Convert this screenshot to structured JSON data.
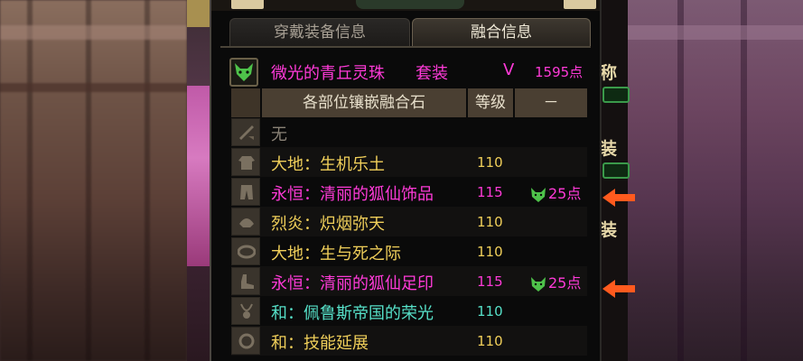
{
  "tabs": {
    "equipped_info": "穿戴装备信息",
    "fusion_info": "融合信息"
  },
  "set": {
    "name": "微光的青丘灵珠",
    "suffix": "套装",
    "grade": "V",
    "points": "1595点"
  },
  "table": {
    "header_name": "各部位镶嵌融合石",
    "header_level": "等级",
    "header_extra": "－",
    "rows": [
      {
        "name": "无",
        "level": "",
        "bonus": "",
        "color": "gray",
        "slot_icon": "weapon-icon"
      },
      {
        "name": "大地：生机乐土",
        "level": "110",
        "bonus": "",
        "color": "yellow",
        "slot_icon": "coat-icon"
      },
      {
        "name": "永恒：清丽的狐仙饰品",
        "level": "115",
        "bonus": "25点",
        "color": "magenta",
        "slot_icon": "pants-icon"
      },
      {
        "name": "烈炎：炽烟弥天",
        "level": "110",
        "bonus": "",
        "color": "yellow",
        "slot_icon": "shoulder-icon"
      },
      {
        "name": "大地：生与死之际",
        "level": "110",
        "bonus": "",
        "color": "yellow",
        "slot_icon": "belt-icon"
      },
      {
        "name": "永恒：清丽的狐仙足印",
        "level": "115",
        "bonus": "25点",
        "color": "magenta",
        "slot_icon": "shoes-icon"
      },
      {
        "name": "和：佩鲁斯帝国的荣光",
        "level": "110",
        "bonus": "",
        "color": "cyan",
        "slot_icon": "necklace-icon"
      },
      {
        "name": "和：技能延展",
        "level": "110",
        "bonus": "",
        "color": "yellow",
        "slot_icon": "bracelet-icon"
      }
    ]
  },
  "side_labels": [
    "称",
    "装",
    "装"
  ],
  "colors": {
    "magenta": "#ff3ad8",
    "yellow": "#f0cf5a",
    "cyan": "#56e0c8",
    "gray": "#8a8276",
    "arrow": "#ff5a1e"
  }
}
